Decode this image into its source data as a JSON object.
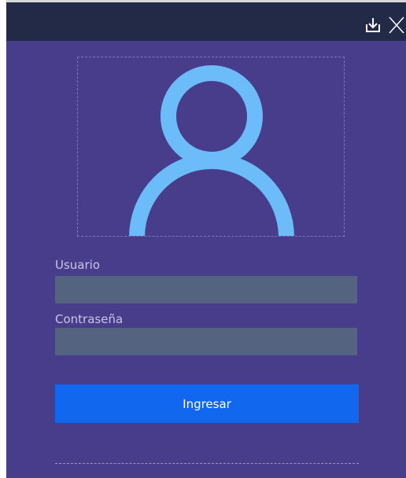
{
  "window": {
    "background": "#483d8b",
    "titlebar_color": "#232a47"
  },
  "titlebar": {
    "minimize_icon": "download-arrow-icon",
    "close_icon": "close-icon"
  },
  "avatar": {
    "icon": "user-silhouette-icon",
    "color": "#6cbcfa"
  },
  "form": {
    "username_label": "Usuario",
    "username_value": "",
    "password_label": "Contraseña",
    "password_value": "",
    "field_color": "#536380"
  },
  "actions": {
    "login_label": "Ingresar",
    "login_color": "#1168ef"
  }
}
